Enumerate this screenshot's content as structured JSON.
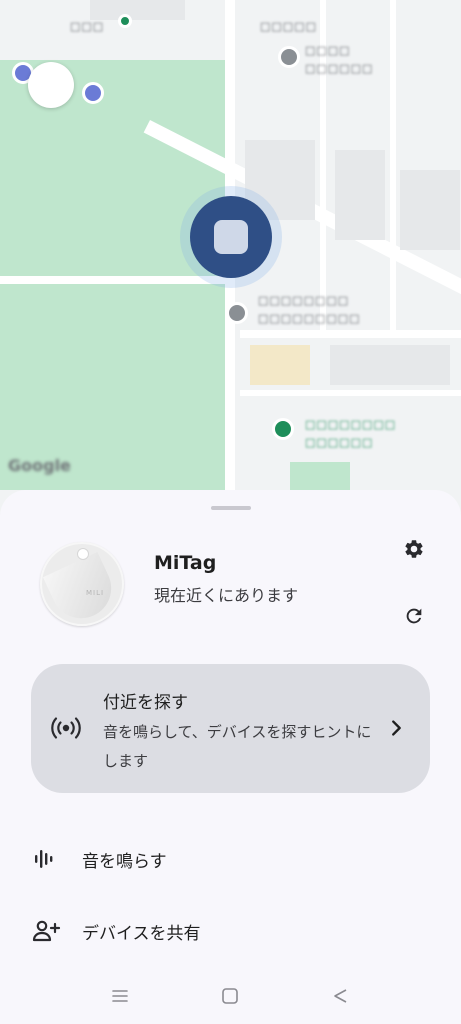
{
  "map": {
    "labels": [
      "□□□",
      "□□□□□",
      "□□□□",
      "□□□□□□",
      "□□□□□□□□",
      "□□□□□□□□□",
      "□□□□□□□□",
      "□□□□□□"
    ],
    "attribution": "Google"
  },
  "device": {
    "name": "MiTag",
    "status": "現在近くにあります",
    "logo_text": "MILI"
  },
  "find_nearby": {
    "title": "付近を探す",
    "description": "音を鳴らして、デバイスを探すヒントにします"
  },
  "actions": {
    "play_sound": "音を鳴らす",
    "share_device": "デバイスを共有"
  },
  "icons": {
    "settings": "gear-icon",
    "refresh": "refresh-icon",
    "signal": "signal-icon",
    "chevron": "chevron-right-icon",
    "sound": "sound-wave-icon",
    "share": "person-add-icon",
    "nav_menu": "menu-icon",
    "nav_home": "home-square-icon",
    "nav_back": "back-triangle-icon"
  },
  "colors": {
    "sheet_bg": "#f8f7fc",
    "card_bg": "#dcdde3",
    "park": "#bfe6cd",
    "marker": "#2f4f86"
  }
}
